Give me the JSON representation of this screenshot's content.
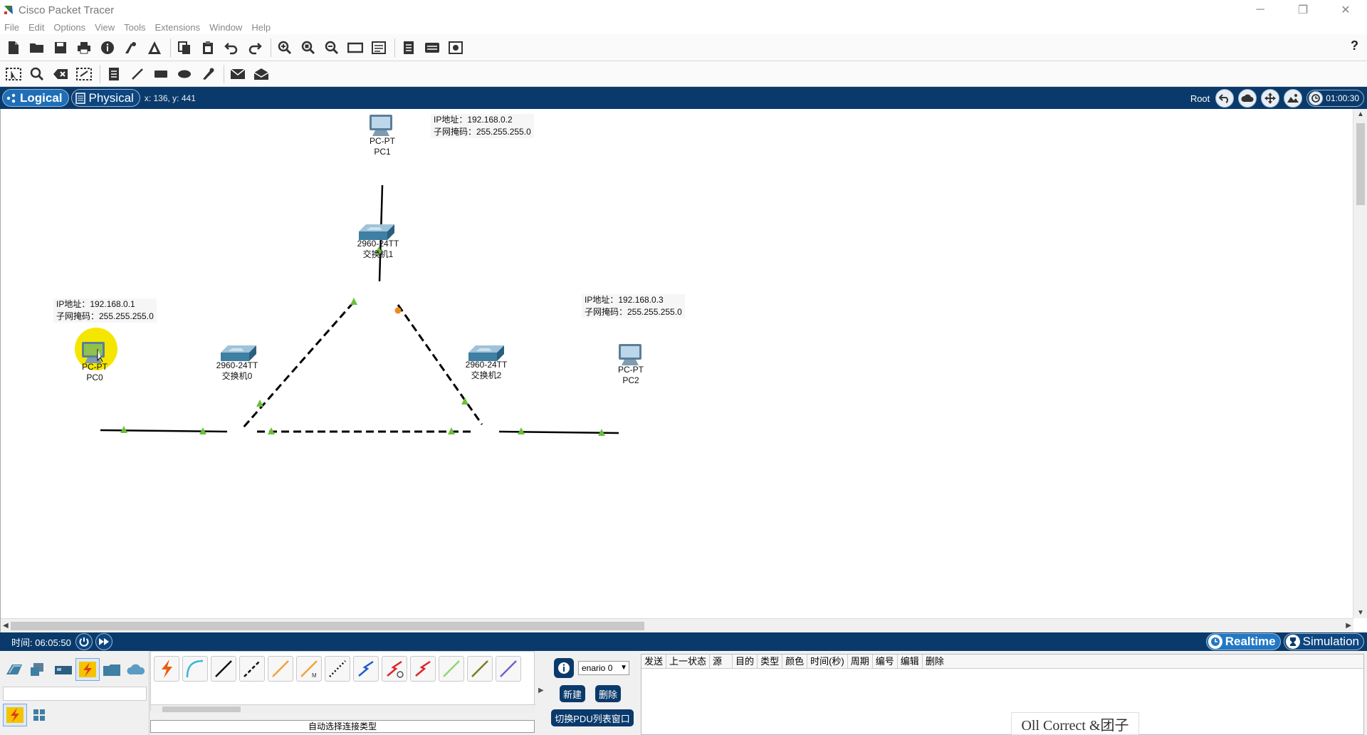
{
  "window": {
    "title": "Cisco Packet Tracer",
    "controls": [
      "─",
      "❐",
      "✕"
    ]
  },
  "menu": [
    "File",
    "Edit",
    "Options",
    "View",
    "Tools",
    "Extensions",
    "Window",
    "Help"
  ],
  "toolbar1": [
    "new-icon",
    "open-icon",
    "save-icon",
    "print-icon",
    "info-icon",
    "network-wizard-icon",
    "activity-wizard-icon",
    "copy-icon",
    "paste-icon",
    "undo-icon",
    "redo-icon",
    "zoom-in-icon",
    "zoom-reset-icon",
    "zoom-out-icon",
    "drawing-palette-icon",
    "custom-device-icon",
    "notes-icon",
    "pdu-icon",
    "screenshot-icon"
  ],
  "toolbar1_help": "?",
  "toolbar2": [
    "select-icon",
    "inspect-icon",
    "delete-icon",
    "resize-icon",
    "note-icon",
    "line-icon",
    "rectangle-icon",
    "ellipse-icon",
    "freeform-icon",
    "simple-pdu-icon",
    "complex-pdu-icon"
  ],
  "viewbar": {
    "tabs": [
      {
        "label": "Logical",
        "active": true
      },
      {
        "label": "Physical",
        "active": false
      }
    ],
    "coords": "x: 136, y: 441",
    "root": "Root",
    "clock": "01:00:30"
  },
  "topology": {
    "devices": {
      "pc0": {
        "model": "PC-PT",
        "name": "PC0"
      },
      "pc1": {
        "model": "PC-PT",
        "name": "PC1"
      },
      "pc2": {
        "model": "PC-PT",
        "name": "PC2"
      },
      "sw0": {
        "model": "2960-24TT",
        "name": "交换机0"
      },
      "sw1": {
        "model": "2960-24TT",
        "name": "交换机1"
      },
      "sw2": {
        "model": "2960-24TT",
        "name": "交换机2"
      }
    },
    "notes": {
      "pc0": {
        "ip": "IP地址：192.168.0.1",
        "mask": "子网掩码：255.255.255.0"
      },
      "pc1": {
        "ip": "IP地址：192.168.0.2",
        "mask": "子网掩码：255.255.255.0"
      },
      "pc2": {
        "ip": "IP地址：192.168.0.3",
        "mask": "子网掩码：255.255.255.0"
      }
    },
    "colors": {
      "link_up": "#6abf3a",
      "link_blocking": "#f08a1c",
      "highlight": "#f5e600"
    }
  },
  "statusbar": {
    "time": "时间: 06:05:50",
    "modes": [
      {
        "label": "Realtime",
        "active": true
      },
      {
        "label": "Simulation",
        "active": false
      }
    ]
  },
  "bottom": {
    "categories_row1": [
      "network-devices-icon",
      "end-devices-icon",
      "components-icon",
      "connections-icon",
      "misc-icon",
      "multiuser-cloud-icon"
    ],
    "categories_row2": [
      "connections-sub-icon",
      "structured-cabling-icon"
    ],
    "connection_types": [
      "auto-connection-icon",
      "console-cable-icon",
      "copper-straight-icon",
      "copper-cross-icon",
      "fiber-icon",
      "phone-cable-icon",
      "coaxial-icon",
      "serial-dce-icon",
      "serial-dte-icon",
      "octal-cable-icon",
      "iot-cable-icon",
      "usb-cable-icon",
      "wireless-cable-icon"
    ],
    "connection_caption": "自动选择连接类型",
    "scenario": {
      "value": "enario 0",
      "new": "新建",
      "delete": "删除",
      "toggle": "切换PDU列表窗口"
    },
    "pdu_columns": [
      "发送",
      "上一状态",
      "源",
      "目的",
      "类型",
      "颜色",
      "时间(秒)",
      "周期",
      "编号",
      "编辑",
      "删除"
    ]
  },
  "watermark": "Oll Correct &团子"
}
